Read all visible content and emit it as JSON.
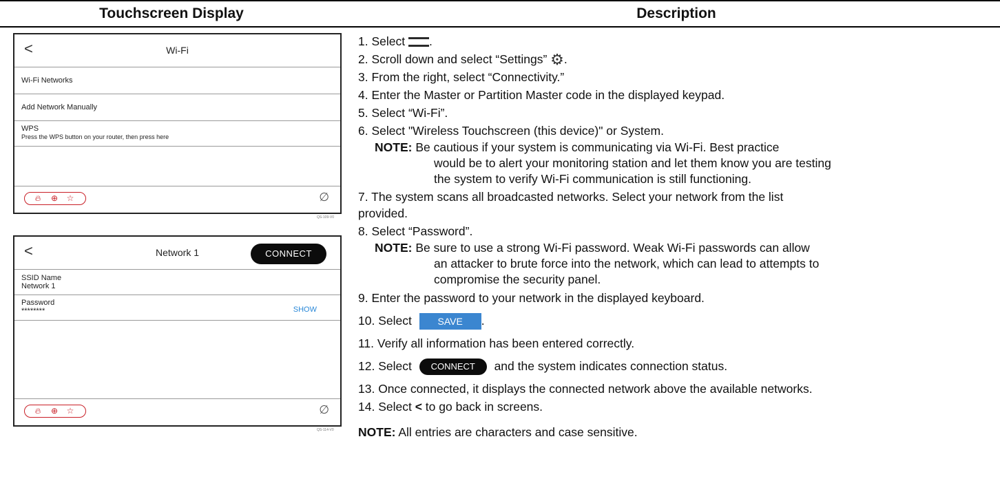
{
  "header": {
    "left": "Touchscreen Display",
    "right": "Description"
  },
  "screen1": {
    "back": "<",
    "title": "Wi-Fi",
    "row1": "Wi-Fi Networks",
    "row2": "Add Network Manually",
    "row3_title": "WPS",
    "row3_sub": "Press the WPS button on your router, then press here",
    "code": "QS-109-V0"
  },
  "screen2": {
    "back": "<",
    "title": "Network 1",
    "connect": "CONNECT",
    "ssid_label": "SSID Name",
    "ssid_value": "Network 1",
    "pw_label": "Password",
    "pw_value": "********",
    "show": "SHOW",
    "code": "QS-114-V0"
  },
  "footer_icons": [
    "fire-icon",
    "medical-icon",
    "police-icon",
    "no-signal-icon"
  ],
  "steps": {
    "s1_a": "1.  Select ",
    "s1_b": ".",
    "s2_a": "2.  Scroll down and select “Settings” ",
    "s2_b": ".",
    "s3": "3.  From the right, select “Connectivity.”",
    "s4": "4.  Enter the Master or Partition Master code in the displayed keypad.",
    "s5": "5.  Select “Wi-Fi”.",
    "s6": "6.  Select \"Wireless Touchscreen (this device)\" or System.",
    "note1_label": "NOTE:",
    "note1_l1": " Be cautious if your system is communicating via Wi-Fi.  Best practice",
    "note1_l2": "would be to alert your monitoring station and let them know you are testing",
    "note1_l3": "the system to verify Wi-Fi communication is still functioning.",
    "s7_l1": "7.  The system scans all broadcasted networks.  Select your network from the list",
    "s7_l2": "provided.",
    "s8": "8.  Select “Password”.",
    "note2_label": "NOTE:",
    "note2_l1": " Be sure to use a strong Wi-Fi password.  Weak Wi-Fi passwords can allow",
    "note2_l2": "an attacker to brute force into the network, which can lead to attempts to",
    "note2_l3": "compromise the security panel.",
    "s9": "9.  Enter the password to your network in the displayed keyboard.",
    "s10_a": "10. Select ",
    "s10_btn": "SAVE",
    "s10_b": ".",
    "s11": "11. Verify all information has been entered correctly.",
    "s12_a": "12. Select ",
    "s12_btn": "CONNECT",
    "s12_b": " and the system indicates connection status.",
    "s13": "13. Once connected, it displays the connected network above the available networks.",
    "s14_a": "14. Select ",
    "s14_bold": "<",
    "s14_b": " to go back in screens.",
    "final_note_label": "NOTE:",
    "final_note": "  All entries are characters and case sensitive."
  }
}
